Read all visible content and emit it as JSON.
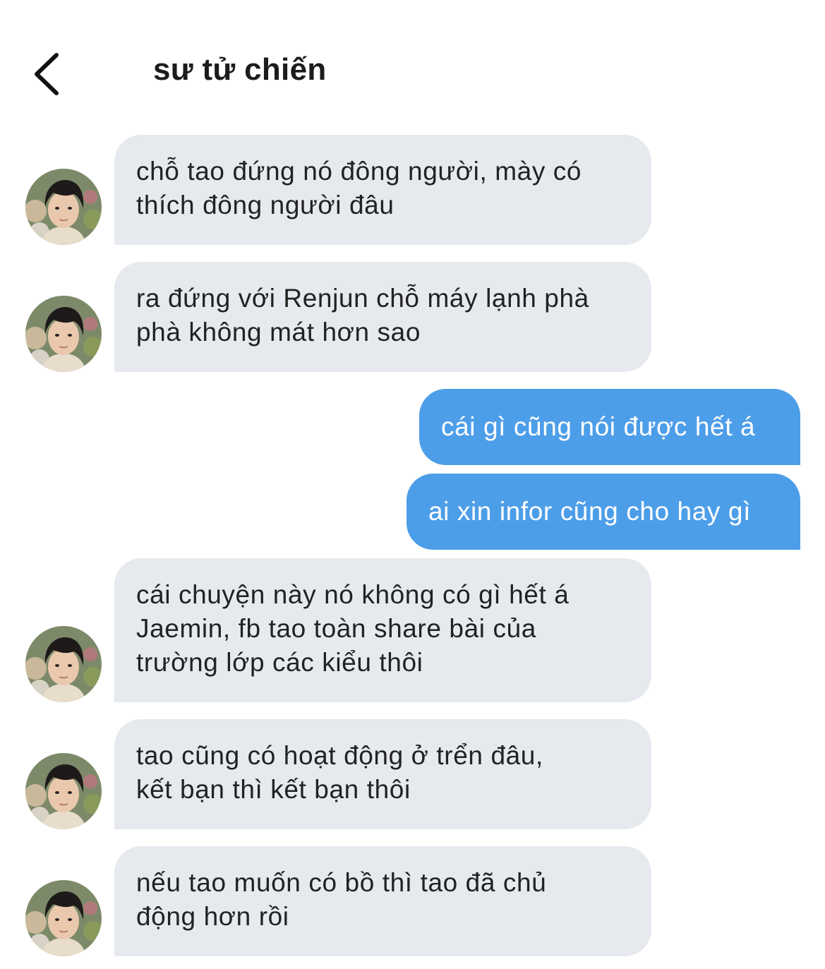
{
  "header": {
    "title": "sư tử chiến",
    "back_icon": "chevron-left-icon"
  },
  "colors": {
    "incoming_bubble": "#e6eaef",
    "outgoing_bubble": "#4d9ee9",
    "incoming_text": "#222222",
    "outgoing_text": "#ffffff"
  },
  "messages": [
    {
      "direction": "in",
      "text": "chỗ tao đứng nó đông người, mày có\nthích đông người đâu"
    },
    {
      "direction": "in",
      "text": "ra đứng với Renjun chỗ máy lạnh phà\nphà không mát hơn sao"
    },
    {
      "direction": "out",
      "text": "cái gì cũng nói được hết á"
    },
    {
      "direction": "out",
      "text": "ai xin infor cũng cho hay gì"
    },
    {
      "direction": "in",
      "text": "cái chuyện này nó không có gì hết á\nJaemin, fb tao toàn share bài của\ntrường lớp các kiểu thôi"
    },
    {
      "direction": "in",
      "text": "tao cũng có hoạt động ở trển đâu,\nkết bạn thì kết bạn thôi"
    },
    {
      "direction": "in",
      "text": "nếu tao muốn có bồ thì tao đã chủ\nđộng hơn rồi"
    }
  ]
}
